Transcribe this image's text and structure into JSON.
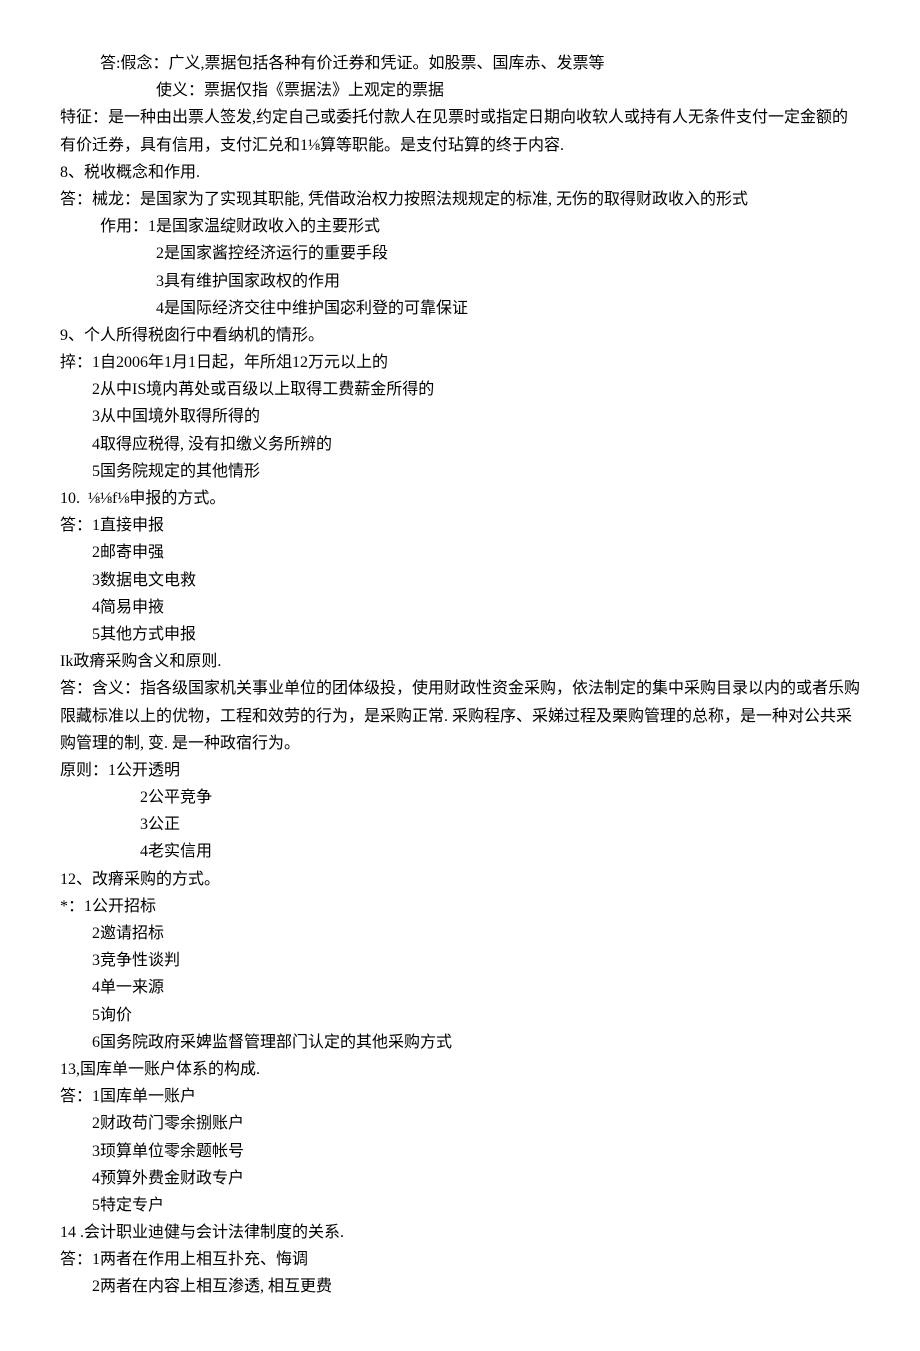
{
  "lines": [
    {
      "cls": "indent1",
      "text": "答:假念：广义,票据包括各种有价迁券和凭证。如股票、国库赤、发票等"
    },
    {
      "cls": "indent3",
      "text": "使义：票据仅指《票据法》上观定的票据"
    },
    {
      "cls": "",
      "text": "特征：是一种由出票人签发,约定自己或委托付款人在见票时或指定日期向收软人或持有人无条件支付一定金额的有价迁券，具有信用，支付汇兑和1⅛算等职能。是支付玷算的终于内容."
    },
    {
      "cls": "",
      "text": "8、税收概念和作用."
    },
    {
      "cls": "",
      "text": "答：械龙：是国家为了实现其职能, 凭借政治权力按照法规规定的标准, 无伤的取得财政收入的形式"
    },
    {
      "cls": "indent1",
      "text": "作用：1是国家温绽财政收入的主要形式"
    },
    {
      "cls": "indent3",
      "text": "2是国家酱控经济运行的重要手段"
    },
    {
      "cls": "indent3",
      "text": "3具有维护国家政权的作用"
    },
    {
      "cls": "indent3",
      "text": "4是国际经济交往中维护国宓利登的可靠保证"
    },
    {
      "cls": "",
      "text": "9、个人所得税囱行中看纳机的情形。"
    },
    {
      "cls": "",
      "text": "捽：1自2006年1月1日起，年所俎12万元以上的"
    },
    {
      "cls": "indent15",
      "text": "2从中IS境内苒处或百级以上取得工费薪金所得的"
    },
    {
      "cls": "indent15",
      "text": "3从中国境外取得所得的"
    },
    {
      "cls": "indent15",
      "text": "4取得应税得, 没有扣缴义务所辨的"
    },
    {
      "cls": "indent15",
      "text": "5国务院规定的其他情形"
    },
    {
      "cls": "",
      "text": "10.  ⅛⅛f⅛申报的方式。"
    },
    {
      "cls": "",
      "text": "答：1直接申报"
    },
    {
      "cls": "indent15",
      "text": "2邮寄申强"
    },
    {
      "cls": "indent15",
      "text": "3数据电文电救"
    },
    {
      "cls": "indent15",
      "text": "4简易申掖"
    },
    {
      "cls": "indent15",
      "text": "5其他方式申报"
    },
    {
      "cls": "",
      "text": "Ik政瘠采购含义和原则."
    },
    {
      "cls": "",
      "text": "答：含义：指各级国家机关事业单位的团体级投，使用财政性资金采购，依法制定的集中采购目录以内的或者乐购限藏标准以上的优物，工程和效劳的行为，是采购正常. 采购程序、采娣过程及栗购管理的总称，是一种对公共采购管理的制, 变. 是一种政宿行为。"
    },
    {
      "cls": "",
      "text": "原则：1公开透明"
    },
    {
      "cls": "indent2",
      "text": "2公平竞争"
    },
    {
      "cls": "indent2",
      "text": "3公正"
    },
    {
      "cls": "indent2",
      "text": "4老实信用"
    },
    {
      "cls": "",
      "text": "12、改瘠采购的方式。"
    },
    {
      "cls": "",
      "text": "*：1公开招标"
    },
    {
      "cls": "indent15",
      "text": "2邀请招标"
    },
    {
      "cls": "indent15",
      "text": "3竞争性谈判"
    },
    {
      "cls": "indent15",
      "text": "4单一来源"
    },
    {
      "cls": "indent15",
      "text": "5询价"
    },
    {
      "cls": "indent15",
      "text": "6国务院政府采婢监督管理部门认定的其他采购方式"
    },
    {
      "cls": "",
      "text": "13,国库单一账户体系的构成."
    },
    {
      "cls": "",
      "text": "答：1国库单一账户"
    },
    {
      "cls": "indent15",
      "text": "2财政苟门零余捌账户"
    },
    {
      "cls": "indent15",
      "text": "3顼算单位零余题帐号"
    },
    {
      "cls": "indent15",
      "text": "4预算外费金财政专户"
    },
    {
      "cls": "indent15",
      "text": "5特定专户"
    },
    {
      "cls": "",
      "text": "14 .会计职业迪健与会计法律制度的关系."
    },
    {
      "cls": "",
      "text": "答：1两者在作用上相互扑充、悔调"
    },
    {
      "cls": "indent15",
      "text": "2两者在内容上相互渗透, 相互更费"
    }
  ]
}
